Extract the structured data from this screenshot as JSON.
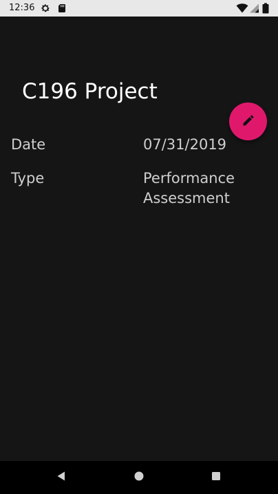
{
  "status_bar": {
    "time": "12:36",
    "icons": [
      "gear-icon",
      "sd-card-icon",
      "wifi-icon",
      "signal-icon",
      "battery-icon"
    ]
  },
  "detail": {
    "title": "C196 Project",
    "rows": [
      {
        "label": "Date",
        "value": "07/31/2019"
      },
      {
        "label": "Type",
        "value": "Performance Assessment"
      }
    ]
  },
  "fab": {
    "icon": "pencil-icon",
    "color": "#e0186c"
  },
  "nav_bar": {
    "buttons": [
      "back-icon",
      "home-icon",
      "recents-icon"
    ]
  },
  "colors": {
    "background": "#151515",
    "status_bar": "#e8e8e8",
    "text_primary": "#ffffff",
    "text_secondary": "#cfcfcf",
    "accent": "#e0186c"
  }
}
